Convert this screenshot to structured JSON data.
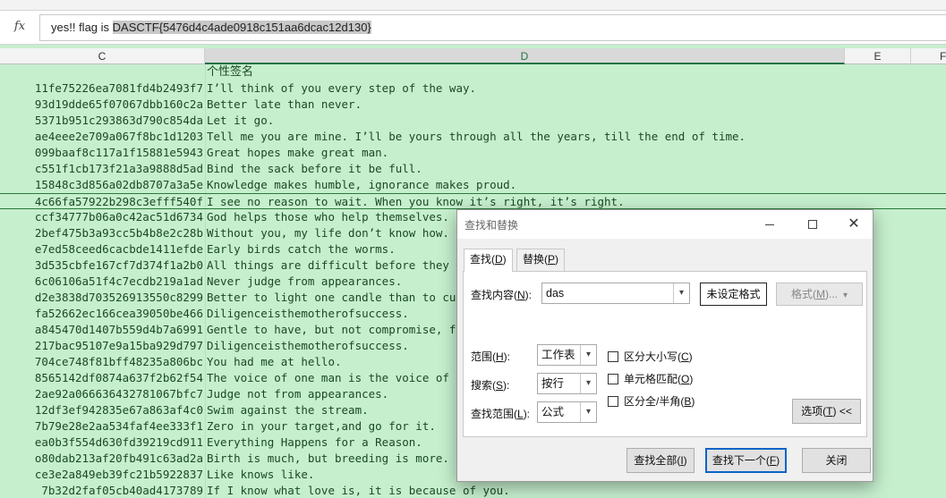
{
  "formula_bar": {
    "fx_label": "fx",
    "content_prefix": "yes!! flag is ",
    "content_selected": "DASCTF{5476d4c4ade0918c151aa6dcac12d130}"
  },
  "columns": [
    {
      "label": "C"
    },
    {
      "label": "D"
    },
    {
      "label": "E"
    },
    {
      "label": "F"
    }
  ],
  "rows": [
    {
      "c": "",
      "d": "个性签名"
    },
    {
      "c": "11fe75226ea7081fd4b2493f7",
      "d": "I’ll think of you every step of the way."
    },
    {
      "c": "93d19dde65f07067dbb160c2a",
      "d": "Better late than never."
    },
    {
      "c": "5371b951c293863d790c854da",
      "d": "Let it go."
    },
    {
      "c": "ae4eee2e709a067f8bc1d1203",
      "d": "Tell me you are mine. I’ll be yours through all the years, till the end of time."
    },
    {
      "c": "099baaf8c117a1f15881e5943",
      "d": "Great hopes make great man."
    },
    {
      "c": "c551f1cb173f21a3a9888d5ad",
      "d": "Bind the sack before it be full."
    },
    {
      "c": "15848c3d856a02db8707a3a5e",
      "d": "Knowledge makes humble, ignorance makes proud."
    },
    {
      "c": "4c66fa57922b298c3efff540f",
      "d": "I see no reason to wait. When you know it’s right, it’s right."
    },
    {
      "c": "ccf34777b06a0c42ac51d6734",
      "d": "God helps those who help themselves."
    },
    {
      "c": "2bef475b3a93cc5b4b8e2c28b",
      "d": "Without you, my life don’t know how."
    },
    {
      "c": "e7ed58ceed6cacbde1411efde",
      "d": "Early birds catch the worms."
    },
    {
      "c": "3d535cbfe167cf7d374f1a2b0",
      "d": "All things are difficult before they are easy."
    },
    {
      "c": "6c06106a51f4c7ecdb219a1ad",
      "d": "Never judge from appearances."
    },
    {
      "c": "d2e3838d703526913550c8299",
      "d": "Better to light one candle than to curse the darkness."
    },
    {
      "c": "fa52662ec166cea39050be466",
      "d": "Diligenceisthemotherofsuccess."
    },
    {
      "c": "a845470d1407b559d4b7a6991",
      "d": "Gentle to have, but not compromise, firm without stiff."
    },
    {
      "c": "217bac95107e9a15ba929d797",
      "d": "Diligenceisthemotherofsuccess."
    },
    {
      "c": "704ce748f81bff48235a806bc",
      "d": "You had me at hello."
    },
    {
      "c": "8565142df0874a637f2b62f54",
      "d": "The voice of one man is the voice of no one."
    },
    {
      "c": "2ae92a066636432781067bfc7",
      "d": "Judge not from appearances."
    },
    {
      "c": "12df3ef942835e67a863af4c0",
      "d": "Swim against the stream."
    },
    {
      "c": "7b79e28e2aa534faf4ee333f1",
      "d": "Zero in your target,and go for it."
    },
    {
      "c": "ea0b3f554d630fd39219cd911",
      "d": "Everything Happens for a Reason."
    },
    {
      "c": "o80dab213af20fb491c63ad2a",
      "d": "Birth is much, but breeding is more."
    },
    {
      "c": "ce3e2a849eb39fc21b5922837",
      "d": "Like knows like."
    },
    {
      "c": "7b32d2faf05cb40ad4173789",
      "d": "If I know what love is, it is because of you."
    }
  ],
  "dialog": {
    "title": "查找和替换",
    "close_glyph": "✕",
    "tabs": [
      {
        "pre": "查找(",
        "key": "D",
        "post": ")"
      },
      {
        "pre": "替换(",
        "key": "P",
        "post": ")"
      }
    ],
    "find_what": {
      "pre": "查找内容(",
      "key": "N",
      "post": "):",
      "value": "das"
    },
    "no_format_label": "未设定格式",
    "format_button": {
      "pre": "格式(",
      "key": "M",
      "post": ")..."
    },
    "within": {
      "pre": "范围(",
      "key": "H",
      "post": "):",
      "value": "工作表"
    },
    "search": {
      "pre": "搜索(",
      "key": "S",
      "post": "):",
      "value": "按行"
    },
    "look_in": {
      "pre": "查找范围(",
      "key": "L",
      "post": "):",
      "value": "公式"
    },
    "match_case": {
      "pre": "区分大小写(",
      "key": "C",
      "post": ")"
    },
    "match_entire": {
      "pre": "单元格匹配(",
      "key": "O",
      "post": ")"
    },
    "match_width": {
      "pre": "区分全/半角(",
      "key": "B",
      "post": ")"
    },
    "options_button": {
      "pre": "选项(",
      "key": "T",
      "post": ") <<"
    },
    "find_all_button": {
      "pre": "查找全部(",
      "key": "I",
      "post": ")"
    },
    "find_next_button": {
      "pre": "查找下一个(",
      "key": "F",
      "post": ")"
    },
    "close_button": "关闭"
  }
}
